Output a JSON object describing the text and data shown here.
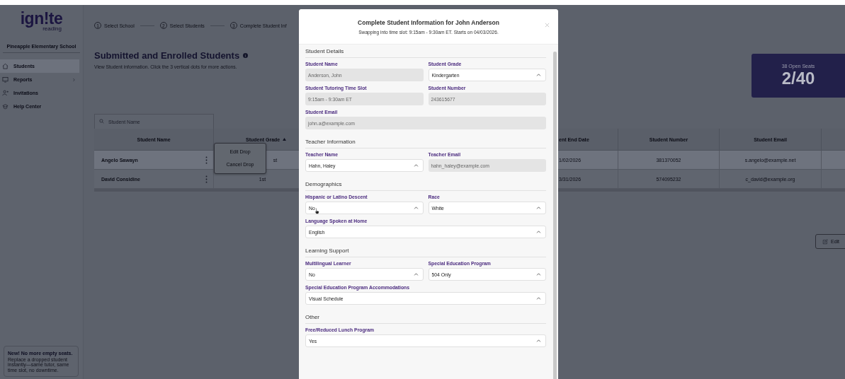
{
  "sidebar": {
    "logo": {
      "word": "ign!te",
      "sub": "reading"
    },
    "school": "Pineapple Elementary School",
    "items": [
      {
        "label": "Students",
        "selected": true,
        "submenu": false
      },
      {
        "label": "Reports",
        "selected": false,
        "submenu": true
      },
      {
        "label": "Invitations",
        "selected": false,
        "submenu": false
      },
      {
        "label": "Help Center",
        "selected": false,
        "submenu": false
      }
    ],
    "promo": {
      "title": "New! No more empty seats.",
      "text": "Replace a dropped student instantly—same tutor, same time slot, no downtime."
    }
  },
  "steps": [
    {
      "number": "1",
      "label": "Select School"
    },
    {
      "number": "2",
      "label": "Select Students"
    },
    {
      "number": "3",
      "label": "Complete Student Inf"
    }
  ],
  "heading": "Submitted and Enrolled Students",
  "subtitle": "View Student information. Click the 3 vertical dots for more actions.",
  "seats": {
    "caption": "38 Open Seats",
    "value": "2/40"
  },
  "search": {
    "placeholder": "Student Name"
  },
  "table": {
    "columns": [
      {
        "label": "Student Name",
        "sorted": false
      },
      {
        "label": "Student Grade",
        "sorted": true
      },
      {
        "label": "ent End Date",
        "sorted": false
      },
      {
        "label": "Student Number",
        "sorted": false
      },
      {
        "label": "Student Email",
        "sorted": false
      }
    ],
    "rows": [
      {
        "selected": true,
        "cells": [
          "Angelo Sawayn",
          "st",
          "1/02/2026",
          "381370052",
          "s.angelo@example.net"
        ]
      },
      {
        "selected": false,
        "cells": [
          "David Considine",
          "1st",
          "3/31/2026",
          "574095232",
          "c_david@example.org"
        ]
      }
    ],
    "row_menu": [
      "Edit Drop",
      "Cancel Drop"
    ]
  },
  "edit_button": "Edit",
  "modal": {
    "title": "Complete Student Information for John Anderson",
    "subtitle": "Swapping into time slot: 9:15am - 9:30am ET. Starts on 04/03/2026.",
    "sections": [
      {
        "title": "Student Details",
        "fields": [
          {
            "label": "Student Name",
            "value": "Anderson, John",
            "kind": "readonly",
            "full": false
          },
          {
            "label": "Student Grade",
            "value": "Kindergarten",
            "kind": "select",
            "full": false
          },
          {
            "label": "Student Tutoring Time Slot",
            "value": "9:15am - 9:30am ET",
            "kind": "readonly",
            "full": false
          },
          {
            "label": "Student Number",
            "value": "243615677",
            "kind": "readonly",
            "full": false
          },
          {
            "label": "Student Email",
            "value": "john.a@example.com",
            "kind": "readonly",
            "full": true
          }
        ]
      },
      {
        "title": "Teacher Information",
        "fields": [
          {
            "label": "Teacher Name",
            "value": "Hahn, Haley",
            "kind": "select",
            "full": false
          },
          {
            "label": "Teacher Email",
            "value": "hahn_haley@example.com",
            "kind": "readonly",
            "full": false
          }
        ]
      },
      {
        "title": "Demographics",
        "fields": [
          {
            "label": "Hispanic or Latino Descent",
            "value": "No",
            "kind": "select",
            "full": false
          },
          {
            "label": "Race",
            "value": "White",
            "kind": "select",
            "full": false
          },
          {
            "label": "Language Spoken at Home",
            "value": "English",
            "kind": "select",
            "full": true
          }
        ]
      },
      {
        "title": "Learning Support",
        "fields": [
          {
            "label": "Multilingual Learner",
            "value": "No",
            "kind": "select",
            "full": false
          },
          {
            "label": "Special Education Program",
            "value": "504 Only",
            "kind": "select",
            "full": false
          },
          {
            "label": "Special Education Program Accommodations",
            "value": "Visual Schedule",
            "kind": "select",
            "full": true
          }
        ]
      },
      {
        "title": "Other",
        "fields": [
          {
            "label": "Free/Reduced Lunch Program",
            "value": "Yes",
            "kind": "select",
            "full": true
          }
        ]
      }
    ]
  }
}
